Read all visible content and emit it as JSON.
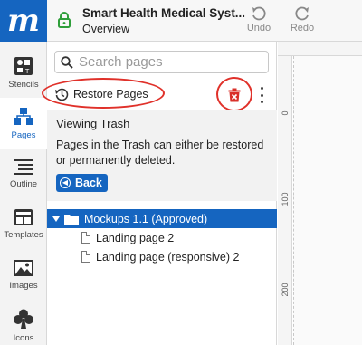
{
  "app": {
    "logo_letter": "m",
    "title": "Smart Health Medical Syst...",
    "subtitle": "Overview"
  },
  "toolbar": {
    "undo_label": "Undo",
    "redo_label": "Redo"
  },
  "rail": {
    "items": [
      {
        "label": "Stencils",
        "icon": "stencils-icon"
      },
      {
        "label": "Pages",
        "icon": "pages-icon",
        "active": true
      },
      {
        "label": "Outline",
        "icon": "outline-icon"
      },
      {
        "label": "Templates",
        "icon": "templates-icon"
      },
      {
        "label": "Images",
        "icon": "images-icon"
      },
      {
        "label": "Icons",
        "icon": "icons-icon"
      }
    ]
  },
  "search": {
    "placeholder": "Search pages"
  },
  "actions": {
    "restore_label": "Restore Pages"
  },
  "trash": {
    "title": "Viewing Trash",
    "description": "Pages in the Trash can either be restored or permanently deleted.",
    "back_label": "Back"
  },
  "tree": {
    "folder": "Mockups 1.1 (Approved)",
    "pages": [
      "Landing page 2",
      "Landing page (responsive) 2"
    ]
  },
  "ruler": {
    "marks": [
      "0",
      "100",
      "200"
    ]
  },
  "colors": {
    "brand": "#1565c0",
    "highlight": "#e0312a"
  }
}
